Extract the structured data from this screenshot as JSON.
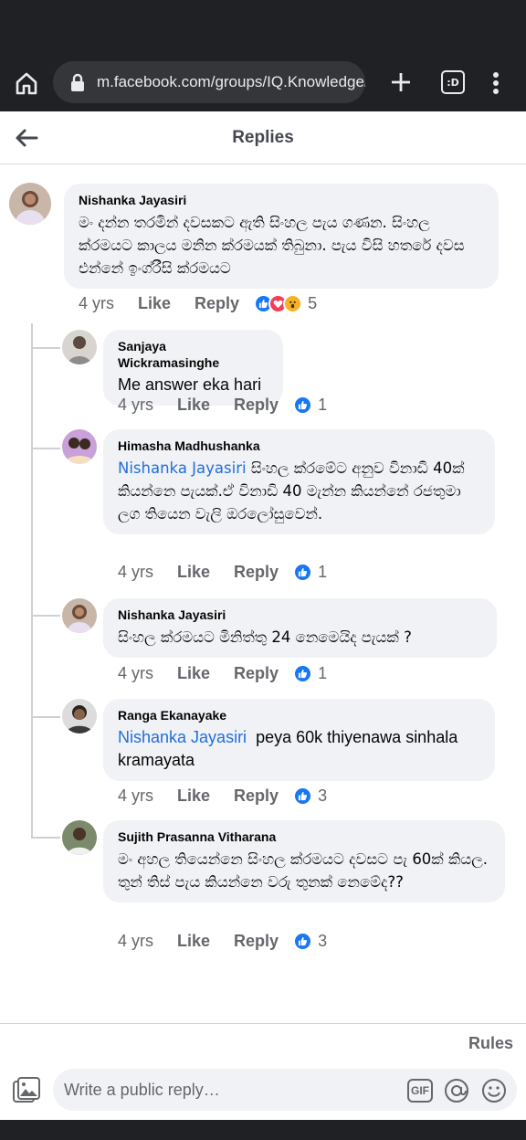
{
  "browser": {
    "url": "m.facebook.com/groups/IQ.Knowledge/p",
    "tabs_label": ":D"
  },
  "header": {
    "title": "Replies"
  },
  "comments": [
    {
      "author": "Nishanka Jayasiri",
      "mention": "",
      "text": "මං දන්න තරමින් දවසකට ඇති සිංහල පැය ගණන. සිංහල ක්රමයට කාලය මනින ක්රමයක් තිබුනා. පැය විසි හතරේ දවස එන්නේ ඉංග්රීසි ක්රමයට",
      "time": "4 yrs",
      "like": "Like",
      "reply": "Reply",
      "reactions": "5"
    },
    {
      "author": "Sanjaya Wickramasinghe",
      "mention": "",
      "text": "Me answer eka hari",
      "time": "4 yrs",
      "like": "Like",
      "reply": "Reply",
      "reactions": "1"
    },
    {
      "author": "Himasha Madhushanka",
      "mention": "Nishanka Jayasiri",
      "text": "සිංහල ක්රමේට අනුව විනාඩි 40ක් කියන්නෙ පැයක්.ඒ විනාඩි 40 මැන්න කියන්නේ රජතුමා ලග තියෙන වැලි ඔරලෝසුවෙන්.",
      "time": "4 yrs",
      "like": "Like",
      "reply": "Reply",
      "reactions": "1"
    },
    {
      "author": "Nishanka Jayasiri",
      "mention": "",
      "text": "සිංහල ක්රමයට මිනිත්තු 24 නෙමෙයිද පැයක් ?",
      "time": "4 yrs",
      "like": "Like",
      "reply": "Reply",
      "reactions": "1"
    },
    {
      "author": "Ranga Ekanayake",
      "mention": "Nishanka Jayasiri",
      "text": "peya 60k thiyenawa sinhala kramayata",
      "time": "4 yrs",
      "like": "Like",
      "reply": "Reply",
      "reactions": "3"
    },
    {
      "author": "Sujith Prasanna Vitharana",
      "mention": "",
      "text": "මං අහල තියෙන්නෙ සිංහල ක්රමයට දවසට පැ 60ක් කියල. තුන් තිස් පැය කියන්නෙ වරු තුනක් නෙමේද??",
      "time": "4 yrs",
      "like": "Like",
      "reply": "Reply",
      "reactions": "3"
    }
  ],
  "composer": {
    "rules_label": "Rules",
    "placeholder": "Write a public reply…",
    "gif_label": "GIF"
  },
  "colors": {
    "bubble": "#f0f2f5",
    "mention": "#216fdb",
    "like_reaction": "#1877f2",
    "chrome_dark": "#202124"
  }
}
